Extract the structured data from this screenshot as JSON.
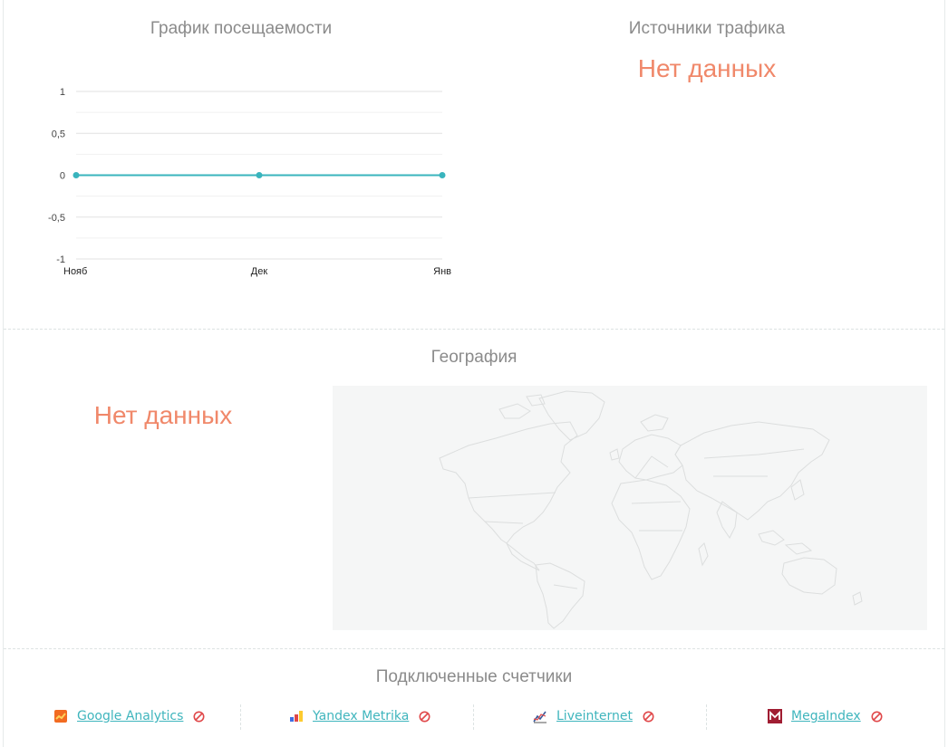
{
  "visits": {
    "title": "График посещаемости",
    "chart_data": {
      "type": "line",
      "categories": [
        "Нояб",
        "Дек",
        "Янв"
      ],
      "series": [
        {
          "values": [
            0,
            0,
            0
          ]
        }
      ],
      "ylim": [
        -1,
        1
      ],
      "yticks": [
        1,
        0.5,
        0,
        -0.5,
        -1
      ],
      "ytick_labels": [
        "1",
        "0,5",
        "0",
        "-0,5",
        "-1"
      ],
      "line_color": "#39b4bd",
      "grid": true
    }
  },
  "traffic": {
    "title": "Источники трафика",
    "empty_text": "Нет данных"
  },
  "geo": {
    "title": "География",
    "empty_text": "Нет данных"
  },
  "counters": {
    "title": "Подключенные счетчики",
    "items": [
      {
        "label": "Google Analytics",
        "icon": "google-analytics-icon",
        "status": "not-connected"
      },
      {
        "label": "Yandex Metrika",
        "icon": "yandex-metrika-icon",
        "status": "not-connected"
      },
      {
        "label": "Liveinternet",
        "icon": "liveinternet-icon",
        "status": "not-connected"
      },
      {
        "label": "MegaIndex",
        "icon": "megaindex-icon",
        "status": "not-connected"
      }
    ]
  },
  "colors": {
    "accent": "#3fb5bd",
    "nodata": "#f0886a",
    "ban": "#e0484a"
  }
}
